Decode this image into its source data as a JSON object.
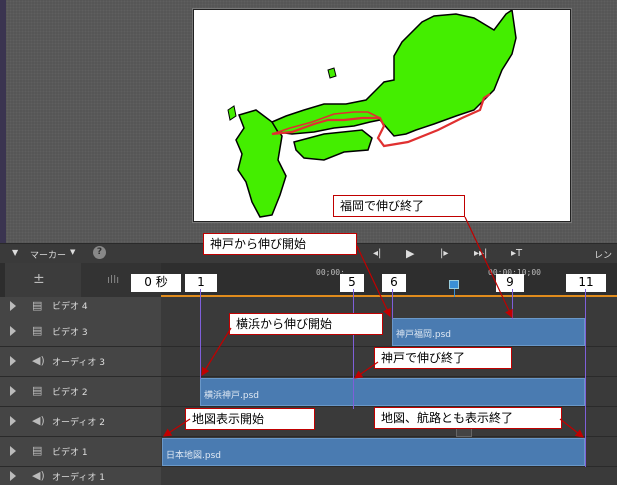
{
  "toolbar": {
    "marker_label": "マーカー",
    "help_glyph": "?",
    "render_label": "レンダ"
  },
  "ruler": {
    "timecodes": [
      "00;00;",
      "00;00;10;00"
    ]
  },
  "ruler_labels": {
    "zero": "0 秒",
    "one": "1",
    "five": "5",
    "six": "6",
    "nine": "9",
    "eleven": "11"
  },
  "tracks": [
    {
      "name": "ビデオ 4"
    },
    {
      "name": "ビデオ 3"
    },
    {
      "name": "オーディオ 3"
    },
    {
      "name": "ビデオ 2"
    },
    {
      "name": "オーディオ 2"
    },
    {
      "name": "ビデオ 1"
    },
    {
      "name": "オーディオ 1"
    }
  ],
  "clips": {
    "video3": "神戸福岡.psd",
    "video2": "横浜神戸.psd",
    "video1": "日本地図.psd"
  },
  "callouts": {
    "fukuoka_end": "福岡で伸び終了",
    "kobe_start": "神戸から伸び開始",
    "yokohama_start": "横浜から伸び開始",
    "kobe_end": "神戸で伸び終了",
    "map_start": "地図表示開始",
    "map_end": "地図、航路とも表示終了"
  },
  "colors": {
    "clip": "#4a7bb1",
    "callout_border": "#c00000",
    "route": "#e03030",
    "land": "#44ee00",
    "playhead": "#3a8fd6",
    "work_area": "#e08b1c"
  },
  "icons": [
    "marker-dropdown-icon",
    "help-icon",
    "step-back-icon",
    "play-icon",
    "step-forward-icon",
    "go-to-end-icon",
    "trim-icon",
    "timeline-zoom-icon",
    "audio-wave-icon",
    "film-icon",
    "speaker-icon",
    "expand-track-icon",
    "playhead-icon"
  ]
}
